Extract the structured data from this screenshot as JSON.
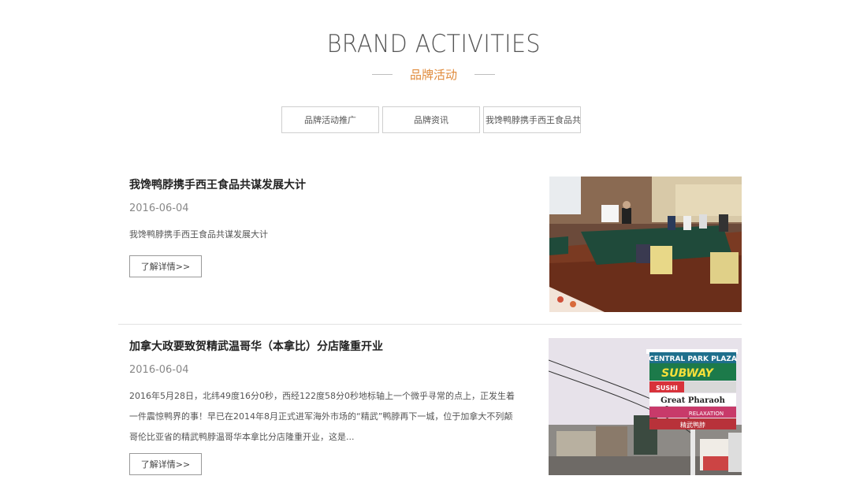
{
  "header": {
    "title": "BRAND ACTIVITIES",
    "subtitle": "品牌活动"
  },
  "tabs": [
    {
      "label": "品牌活动推广"
    },
    {
      "label": "品牌资讯"
    },
    {
      "label": "我馋鸭脖携手西王食品共"
    }
  ],
  "articles": [
    {
      "title": "我馋鸭脖携手西王食品共谋发展大计",
      "date": "2016-06-04",
      "summary": "我馋鸭脖携手西王食品共谋发展大计",
      "more_label": "了解详情>>"
    },
    {
      "title": "加拿大政要致贺精武温哥华（本拿比）分店隆重开业",
      "date": "2016-06-04",
      "summary": "2016年5月28日，北纬49度16分0秒，西经122度58分0秒地标轴上一个微乎寻常的点上，正发生着一件震惊鸭界的事！早已在2014年8月正式进军海外市场的“精武”鸭脖再下一城，位于加拿大不列颠哥伦比亚省的精武鸭脖温哥华本拿比分店隆重开业，这是...",
      "more_label": "了解详情>>"
    }
  ],
  "photo_signage": {
    "plaza": "CENTRAL PARK PLAZA",
    "subway": "SUBWAY",
    "sushi": "SUSHI",
    "pharaoh": "Great Pharaoh",
    "relaxation": "RELAXATION",
    "jingwu": "精武鸭脖"
  }
}
